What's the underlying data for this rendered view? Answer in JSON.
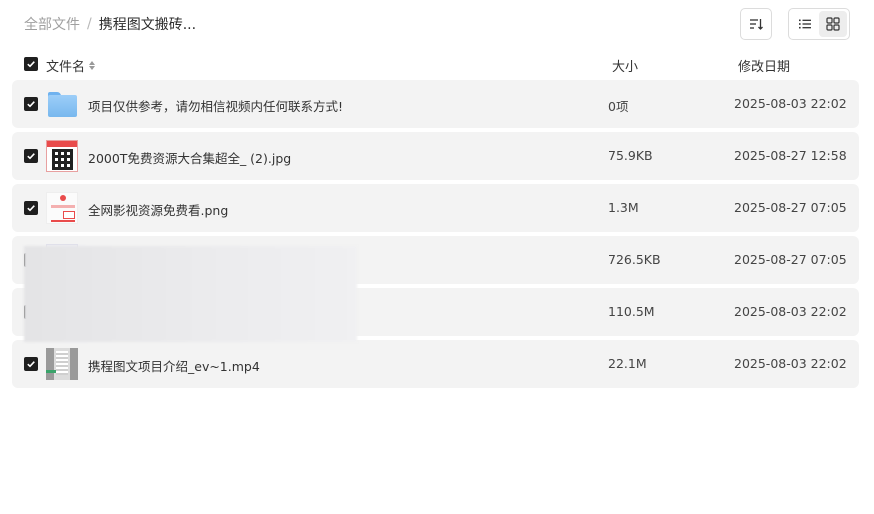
{
  "breadcrumb": {
    "root": "全部文件",
    "separator": "/",
    "current": "携程图文搬砖..."
  },
  "toolbar": {
    "sort_icon": "sort-icon",
    "list_view_icon": "list-view-icon",
    "grid_view_icon": "grid-view-icon",
    "active_view": "grid"
  },
  "columns": {
    "name": "文件名",
    "size": "大小",
    "date": "修改日期"
  },
  "rows": [
    {
      "icon": "folder-icon",
      "name": "项目仅供参考，请勿相信视频内任何联系方式!",
      "size": "0项",
      "date": "2025-08-03 22:02",
      "checked": true
    },
    {
      "icon": "image-thumbnail",
      "name": "2000T免费资源大合集超全_ (2).jpg",
      "size": "75.9KB",
      "date": "2025-08-27 12:58",
      "checked": true
    },
    {
      "icon": "image-thumbnail",
      "name": "全网影视资源免费看.png",
      "size": "1.3M",
      "date": "2025-08-27 07:05",
      "checked": true
    },
    {
      "icon": "image-thumbnail",
      "name": "",
      "size": "726.5KB",
      "date": "2025-08-27 07:05",
      "checked": true
    },
    {
      "icon": "file-thumbnail",
      "name": "",
      "size": "110.5M",
      "date": "2025-08-03 22:02",
      "checked": true
    },
    {
      "icon": "video-thumbnail",
      "name": "携程图文项目介绍_ev~1.mp4",
      "size": "22.1M",
      "date": "2025-08-03 22:02",
      "checked": true
    }
  ],
  "colors": {
    "row_background": "#f3f3f3",
    "checkbox": "#1f1f1f",
    "folder": "#78b8ee"
  }
}
